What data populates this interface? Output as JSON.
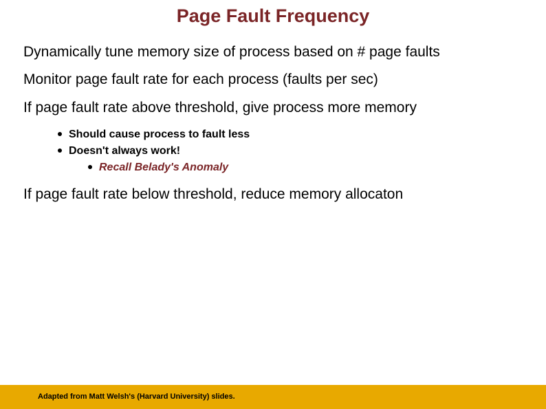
{
  "title": "Page Fault Frequency",
  "points": {
    "p1": "Dynamically tune memory size of process based on # page faults",
    "p2": "Monitor page fault rate for each process (faults per sec)",
    "p3": "If page fault rate above threshold, give process more memory",
    "p4": "If page fault rate below threshold, reduce memory allocaton"
  },
  "subs": {
    "s1": "Should cause process to fault less",
    "s2": "Doesn't always work!",
    "ss1": "Recall Belady's Anomaly"
  },
  "footer": "Adapted from Matt Welsh's (Harvard University) slides."
}
